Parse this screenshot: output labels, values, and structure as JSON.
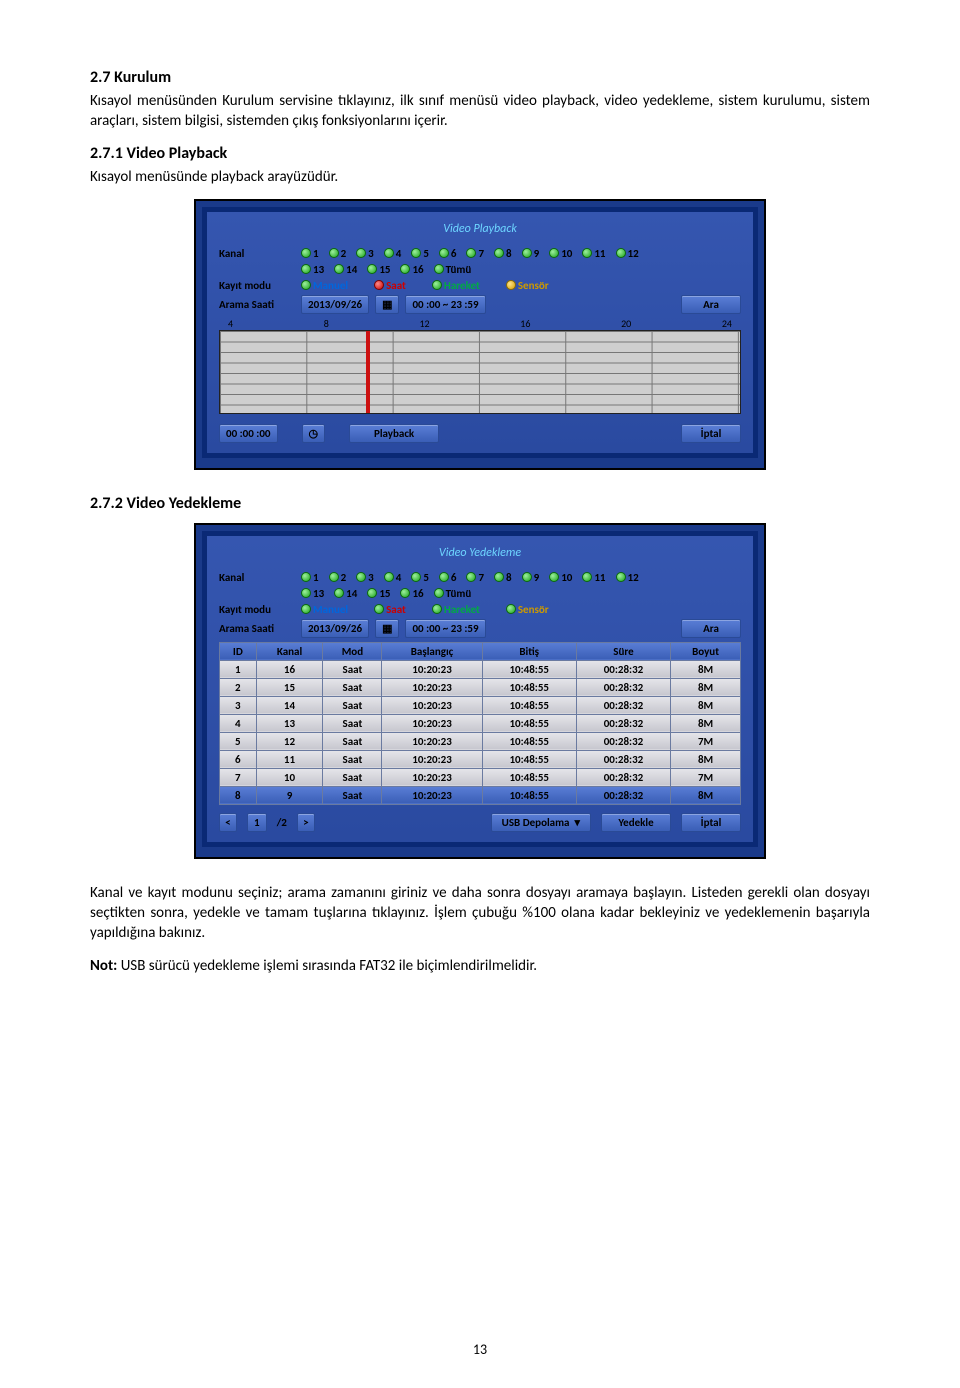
{
  "doc": {
    "sec27_title": "2.7 Kurulum",
    "sec27_body": "Kısayol menüsünden Kurulum servisine tıklayınız, ilk sınıf menüsü video playback, video yedekleme, sistem kurulumu, sistem araçları, sistem bilgisi, sistemden çıkış fonksiyonlarını içerir.",
    "sec271_title": "2.7.1 Video Playback",
    "sec271_body": "Kısayol menüsünde playback arayüzüdür.",
    "sec272_title": "2.7.2 Video Yedekleme",
    "sec272_body1": "Kanal ve kayıt modunu seçiniz; arama zamanını giriniz ve daha sonra dosyayı aramaya başlayın. Listeden gerekli olan dosyayı seçtikten sonra, yedekle ve tamam tuşlarına tıklayınız. İşlem çubuğu %100 olana kadar bekleyiniz ve yedeklemenin başarıyla yapıldığına bakınız.",
    "note_label": "Not:",
    "note_body": " USB sürücü yedekleme işlemi sırasında FAT32 ile biçimlendirilmelidir.",
    "page_number": "13"
  },
  "playback": {
    "title": "Video Playback",
    "labels": {
      "kanal": "Kanal",
      "kayit_modu": "Kayıt modu",
      "arama_saati": "Arama Saati"
    },
    "channels_row1": [
      "1",
      "2",
      "3",
      "4",
      "5",
      "6",
      "7",
      "8",
      "9",
      "10",
      "11",
      "12"
    ],
    "channels_row2": [
      "13",
      "14",
      "15",
      "16"
    ],
    "tumu": "Tümü",
    "modes": {
      "manuel": "Manuel",
      "saat": "Saat",
      "hareket": "Hareket",
      "sensor": "Sensör"
    },
    "date": "2013/09/26",
    "time_range": "00 :00 ~ 23 :59",
    "ara": "Ara",
    "ticks": [
      "4",
      "8",
      "12",
      "16",
      "20",
      "24"
    ],
    "bottom_time": "00 :00 :00",
    "playback_btn": "Playback",
    "cancel_btn": "İptal"
  },
  "backup": {
    "title": "Video Yedekleme",
    "labels": {
      "kanal": "Kanal",
      "kayit_modu": "Kayıt modu",
      "arama_saati": "Arama Saati"
    },
    "channels_row1": [
      "1",
      "2",
      "3",
      "4",
      "5",
      "6",
      "7",
      "8",
      "9",
      "10",
      "11",
      "12"
    ],
    "channels_row2": [
      "13",
      "14",
      "15",
      "16"
    ],
    "tumu": "Tümü",
    "modes": {
      "manuel": "Manuel",
      "saat": "Saat",
      "hareket": "Hareket",
      "sensor": "Sensör"
    },
    "date": "2013/09/26",
    "time_range": "00 :00 ~ 23 :59",
    "ara": "Ara",
    "headers": [
      "ID",
      "Kanal",
      "Mod",
      "Başlangıç",
      "Bitiş",
      "Süre",
      "Boyut"
    ],
    "rows": [
      {
        "id": "1",
        "kanal": "16",
        "mod": "Saat",
        "bas": "10:20:23",
        "bit": "10:48:55",
        "sure": "00:28:32",
        "boyut": "8M"
      },
      {
        "id": "2",
        "kanal": "15",
        "mod": "Saat",
        "bas": "10:20:23",
        "bit": "10:48:55",
        "sure": "00:28:32",
        "boyut": "8M"
      },
      {
        "id": "3",
        "kanal": "14",
        "mod": "Saat",
        "bas": "10:20:23",
        "bit": "10:48:55",
        "sure": "00:28:32",
        "boyut": "8M"
      },
      {
        "id": "4",
        "kanal": "13",
        "mod": "Saat",
        "bas": "10:20:23",
        "bit": "10:48:55",
        "sure": "00:28:32",
        "boyut": "8M"
      },
      {
        "id": "5",
        "kanal": "12",
        "mod": "Saat",
        "bas": "10:20:23",
        "bit": "10:48:55",
        "sure": "00:28:32",
        "boyut": "7M"
      },
      {
        "id": "6",
        "kanal": "11",
        "mod": "Saat",
        "bas": "10:20:23",
        "bit": "10:48:55",
        "sure": "00:28:32",
        "boyut": "8M"
      },
      {
        "id": "7",
        "kanal": "10",
        "mod": "Saat",
        "bas": "10:20:23",
        "bit": "10:48:55",
        "sure": "00:28:32",
        "boyut": "7M"
      },
      {
        "id": "8",
        "kanal": "9",
        "mod": "Saat",
        "bas": "10:20:23",
        "bit": "10:48:55",
        "sure": "00:28:32",
        "boyut": "8M"
      }
    ],
    "pager": {
      "prev": "<",
      "page": "1",
      "total": "/2",
      "next": ">"
    },
    "storage": "USB Depolama",
    "yedekle": "Yedekle",
    "iptal": "İptal"
  }
}
